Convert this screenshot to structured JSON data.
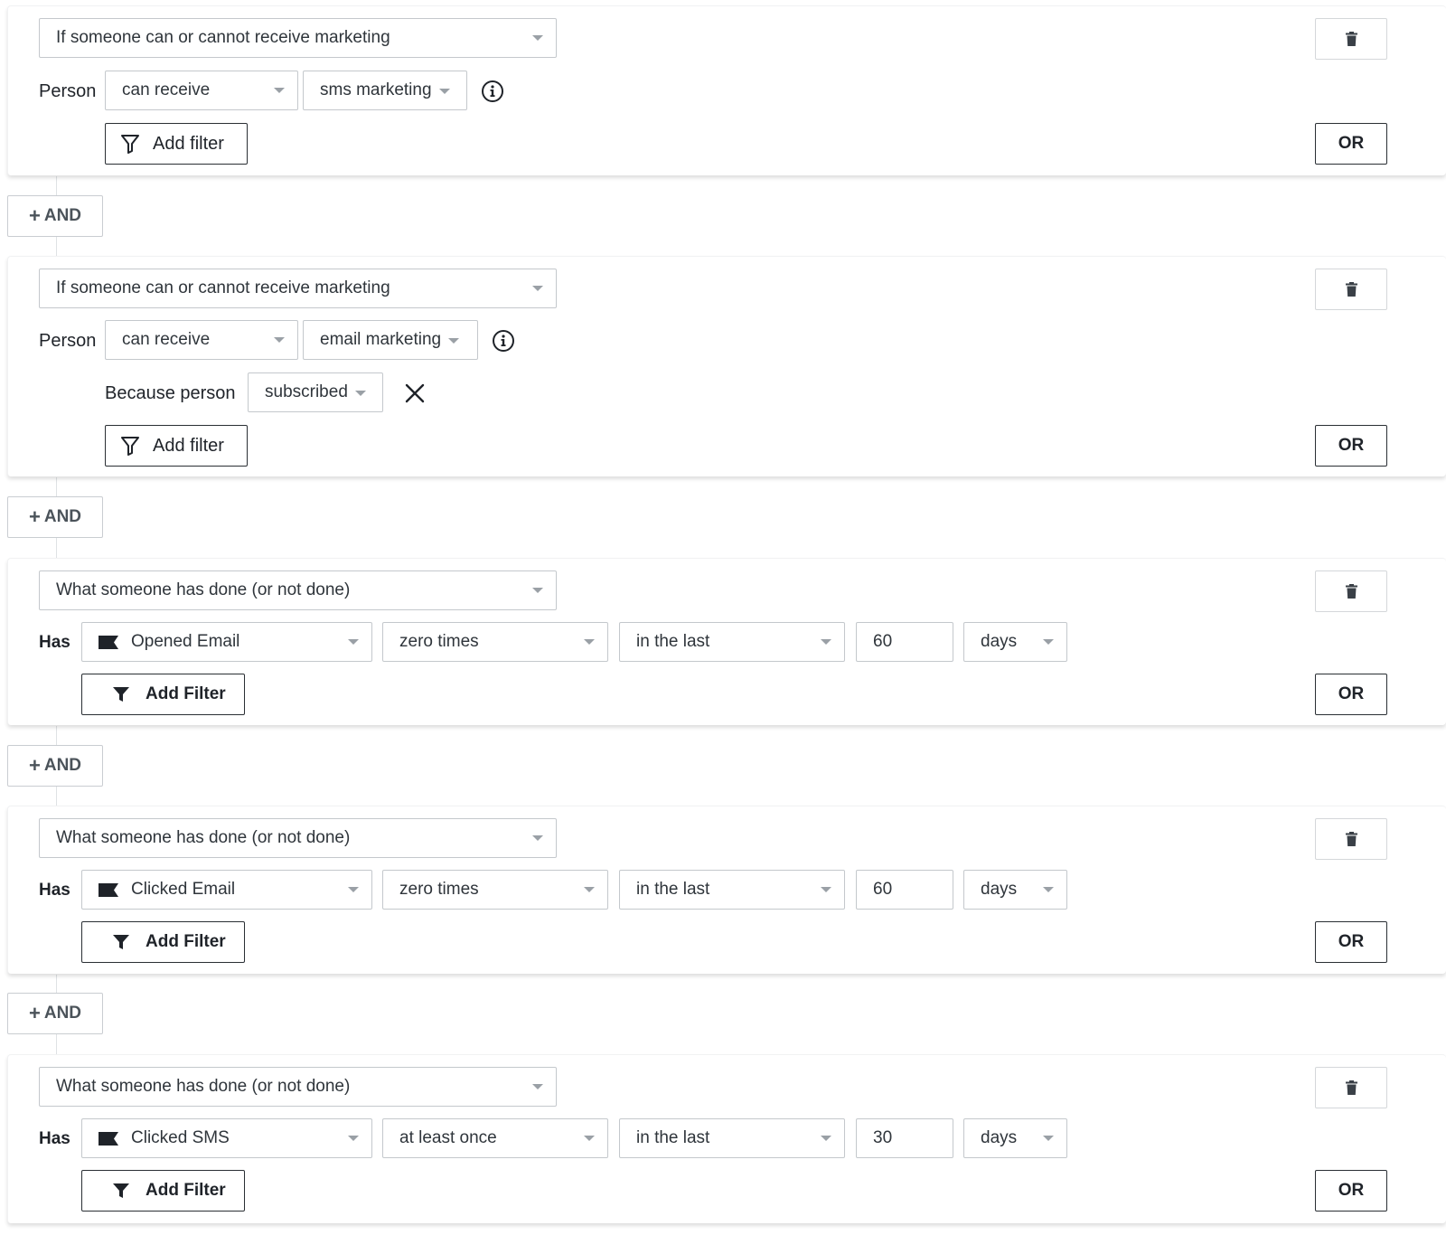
{
  "and_label": "AND",
  "or_label": "OR",
  "blocks": [
    {
      "condition_type": "If someone can or cannot receive marketing",
      "person_label": "Person",
      "receive": "can receive",
      "channel": "sms marketing",
      "add_filter": "Add filter"
    },
    {
      "condition_type": "If someone can or cannot receive marketing",
      "person_label": "Person",
      "receive": "can receive",
      "channel": "email marketing",
      "because_label": "Because person",
      "because_value": "subscribed",
      "add_filter": "Add filter"
    },
    {
      "condition_type": "What someone has done (or not done)",
      "has_label": "Has",
      "metric": "Opened Email",
      "frequency": "zero times",
      "timeframe": "in the last",
      "amount": "60",
      "unit": "days",
      "add_filter": "Add Filter"
    },
    {
      "condition_type": "What someone has done (or not done)",
      "has_label": "Has",
      "metric": "Clicked Email",
      "frequency": "zero times",
      "timeframe": "in the last",
      "amount": "60",
      "unit": "days",
      "add_filter": "Add Filter"
    },
    {
      "condition_type": "What someone has done (or not done)",
      "has_label": "Has",
      "metric": "Clicked SMS",
      "frequency": "at least once",
      "timeframe": "in the last",
      "amount": "30",
      "unit": "days",
      "add_filter": "Add Filter"
    }
  ],
  "icons": {
    "trash": "trash-icon",
    "filter_outline": "filter-outline-icon",
    "filter_solid": "filter-solid-icon",
    "info": "info-icon",
    "close": "close-icon",
    "flag": "flag-icon",
    "caret": "caret-down-icon"
  },
  "colors": {
    "border": "#c4c8cc",
    "text": "#1f2329",
    "icon": "#3a4047",
    "divider": "#dfe2e5"
  }
}
